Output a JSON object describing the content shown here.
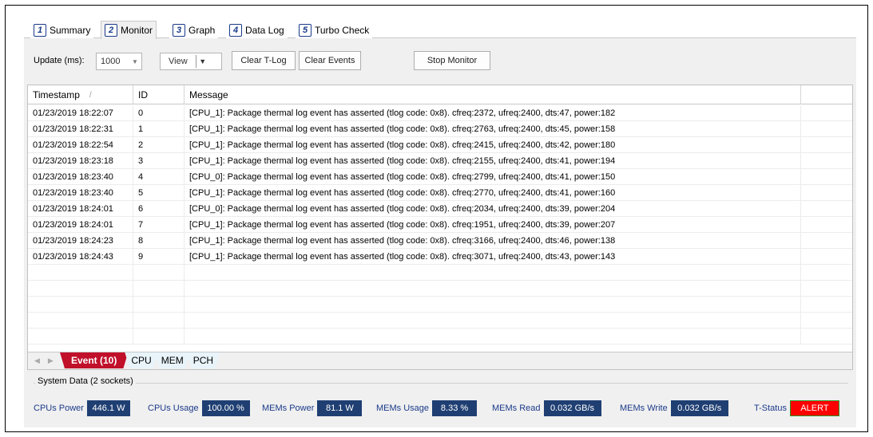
{
  "tabs": [
    {
      "num": "1",
      "label": "Summary"
    },
    {
      "num": "2",
      "label": "Monitor"
    },
    {
      "num": "3",
      "label": "Graph"
    },
    {
      "num": "4",
      "label": "Data Log"
    },
    {
      "num": "5",
      "label": "Turbo Check"
    }
  ],
  "active_tab": "Monitor",
  "toolbar": {
    "update_label": "Update (ms):",
    "update_value": "1000",
    "view_label": "View",
    "clear_tlog": "Clear T-Log",
    "clear_events": "Clear Events",
    "stop_monitor": "Stop Monitor"
  },
  "grid": {
    "columns": [
      "Timestamp",
      "ID",
      "Message",
      ""
    ],
    "sort_indicator": "/",
    "rows": [
      {
        "timestamp": "01/23/2019 18:22:07",
        "id": "0",
        "message": "[CPU_1]: Package thermal log event has asserted (tlog code: 0x8). cfreq:2372, ufreq:2400, dts:47, power:182"
      },
      {
        "timestamp": "01/23/2019 18:22:31",
        "id": "1",
        "message": "[CPU_1]: Package thermal log event has asserted (tlog code: 0x8). cfreq:2763, ufreq:2400, dts:45, power:158"
      },
      {
        "timestamp": "01/23/2019 18:22:54",
        "id": "2",
        "message": "[CPU_1]: Package thermal log event has asserted (tlog code: 0x8). cfreq:2415, ufreq:2400, dts:42, power:180"
      },
      {
        "timestamp": "01/23/2019 18:23:18",
        "id": "3",
        "message": "[CPU_1]: Package thermal log event has asserted (tlog code: 0x8). cfreq:2155, ufreq:2400, dts:41, power:194"
      },
      {
        "timestamp": "01/23/2019 18:23:40",
        "id": "4",
        "message": "[CPU_0]: Package thermal log event has asserted (tlog code: 0x8). cfreq:2799, ufreq:2400, dts:41, power:150"
      },
      {
        "timestamp": "01/23/2019 18:23:40",
        "id": "5",
        "message": "[CPU_1]: Package thermal log event has asserted (tlog code: 0x8). cfreq:2770, ufreq:2400, dts:41, power:160"
      },
      {
        "timestamp": "01/23/2019 18:24:01",
        "id": "6",
        "message": "[CPU_0]: Package thermal log event has asserted (tlog code: 0x8). cfreq:2034, ufreq:2400, dts:39, power:204"
      },
      {
        "timestamp": "01/23/2019 18:24:01",
        "id": "7",
        "message": "[CPU_1]: Package thermal log event has asserted (tlog code: 0x8). cfreq:1951, ufreq:2400, dts:39, power:207"
      },
      {
        "timestamp": "01/23/2019 18:24:23",
        "id": "8",
        "message": "[CPU_1]: Package thermal log event has asserted (tlog code: 0x8). cfreq:3166, ufreq:2400, dts:46, power:138"
      },
      {
        "timestamp": "01/23/2019 18:24:43",
        "id": "9",
        "message": "[CPU_1]: Package thermal log event has asserted (tlog code: 0x8). cfreq:3071, ufreq:2400, dts:43, power:143"
      }
    ]
  },
  "bottom_tabs": [
    "Event (10)",
    "CPU",
    "MEM",
    "PCH"
  ],
  "system_data": {
    "legend": "System Data (2 sockets)",
    "metrics": [
      {
        "label": "CPUs Power",
        "value": "446.1 W"
      },
      {
        "label": "CPUs Usage",
        "value": "100.00 %"
      },
      {
        "label": "MEMs Power",
        "value": "81.1 W"
      },
      {
        "label": "MEMs Usage",
        "value": "8.33 %"
      },
      {
        "label": "MEMs Read",
        "value": "0.032 GB/s"
      },
      {
        "label": "MEMs Write",
        "value": "0.032 GB/s"
      },
      {
        "label": "T-Status",
        "value": "ALERT"
      }
    ]
  },
  "colors": {
    "value_bg": "#1f3f73",
    "alert_bg": "#ff0000",
    "event_tab_bg": "#c0102a",
    "label_blue": "#1a3a8a"
  }
}
